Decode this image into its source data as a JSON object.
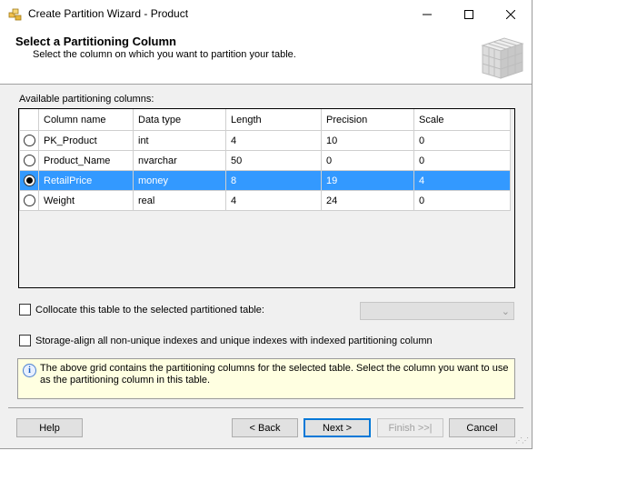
{
  "window": {
    "title": "Create Partition Wizard - Product",
    "controls": {
      "minimize": "—",
      "maximize": "☐",
      "close": "✕"
    }
  },
  "header": {
    "title": "Select a Partitioning Column",
    "subtitle": "Select the column on which you want to partition your table."
  },
  "grid": {
    "label": "Available partitioning columns:",
    "columns": [
      "Column name",
      "Data type",
      "Length",
      "Precision",
      "Scale"
    ],
    "rows": [
      {
        "selected": false,
        "name": "PK_Product",
        "type": "int",
        "length": "4",
        "precision": "10",
        "scale": "0"
      },
      {
        "selected": false,
        "name": "Product_Name",
        "type": "nvarchar",
        "length": "50",
        "precision": "0",
        "scale": "0"
      },
      {
        "selected": true,
        "name": "RetailPrice",
        "type": "money",
        "length": "8",
        "precision": "19",
        "scale": "4"
      },
      {
        "selected": false,
        "name": "Weight",
        "type": "real",
        "length": "4",
        "precision": "24",
        "scale": "0"
      }
    ]
  },
  "options": {
    "collocate_label": "Collocate this table to the selected partitioned table:",
    "collocate_checked": false,
    "collocate_combo_value": "",
    "storage_align_label": "Storage-align all non-unique indexes and unique indexes with indexed partitioning column",
    "storage_align_checked": false
  },
  "info": {
    "icon": "info-icon",
    "text": "The above grid contains the partitioning columns for the selected table. Select the column you want to use as the partitioning column in this table."
  },
  "buttons": {
    "help": "Help",
    "back": "< Back",
    "next": "Next >",
    "finish": "Finish >>|",
    "cancel": "Cancel"
  },
  "colors": {
    "selection": "#3399ff",
    "info_background": "#ffffe1",
    "dialog_background": "#f0f0f0",
    "default_button_border": "#0078d7"
  }
}
